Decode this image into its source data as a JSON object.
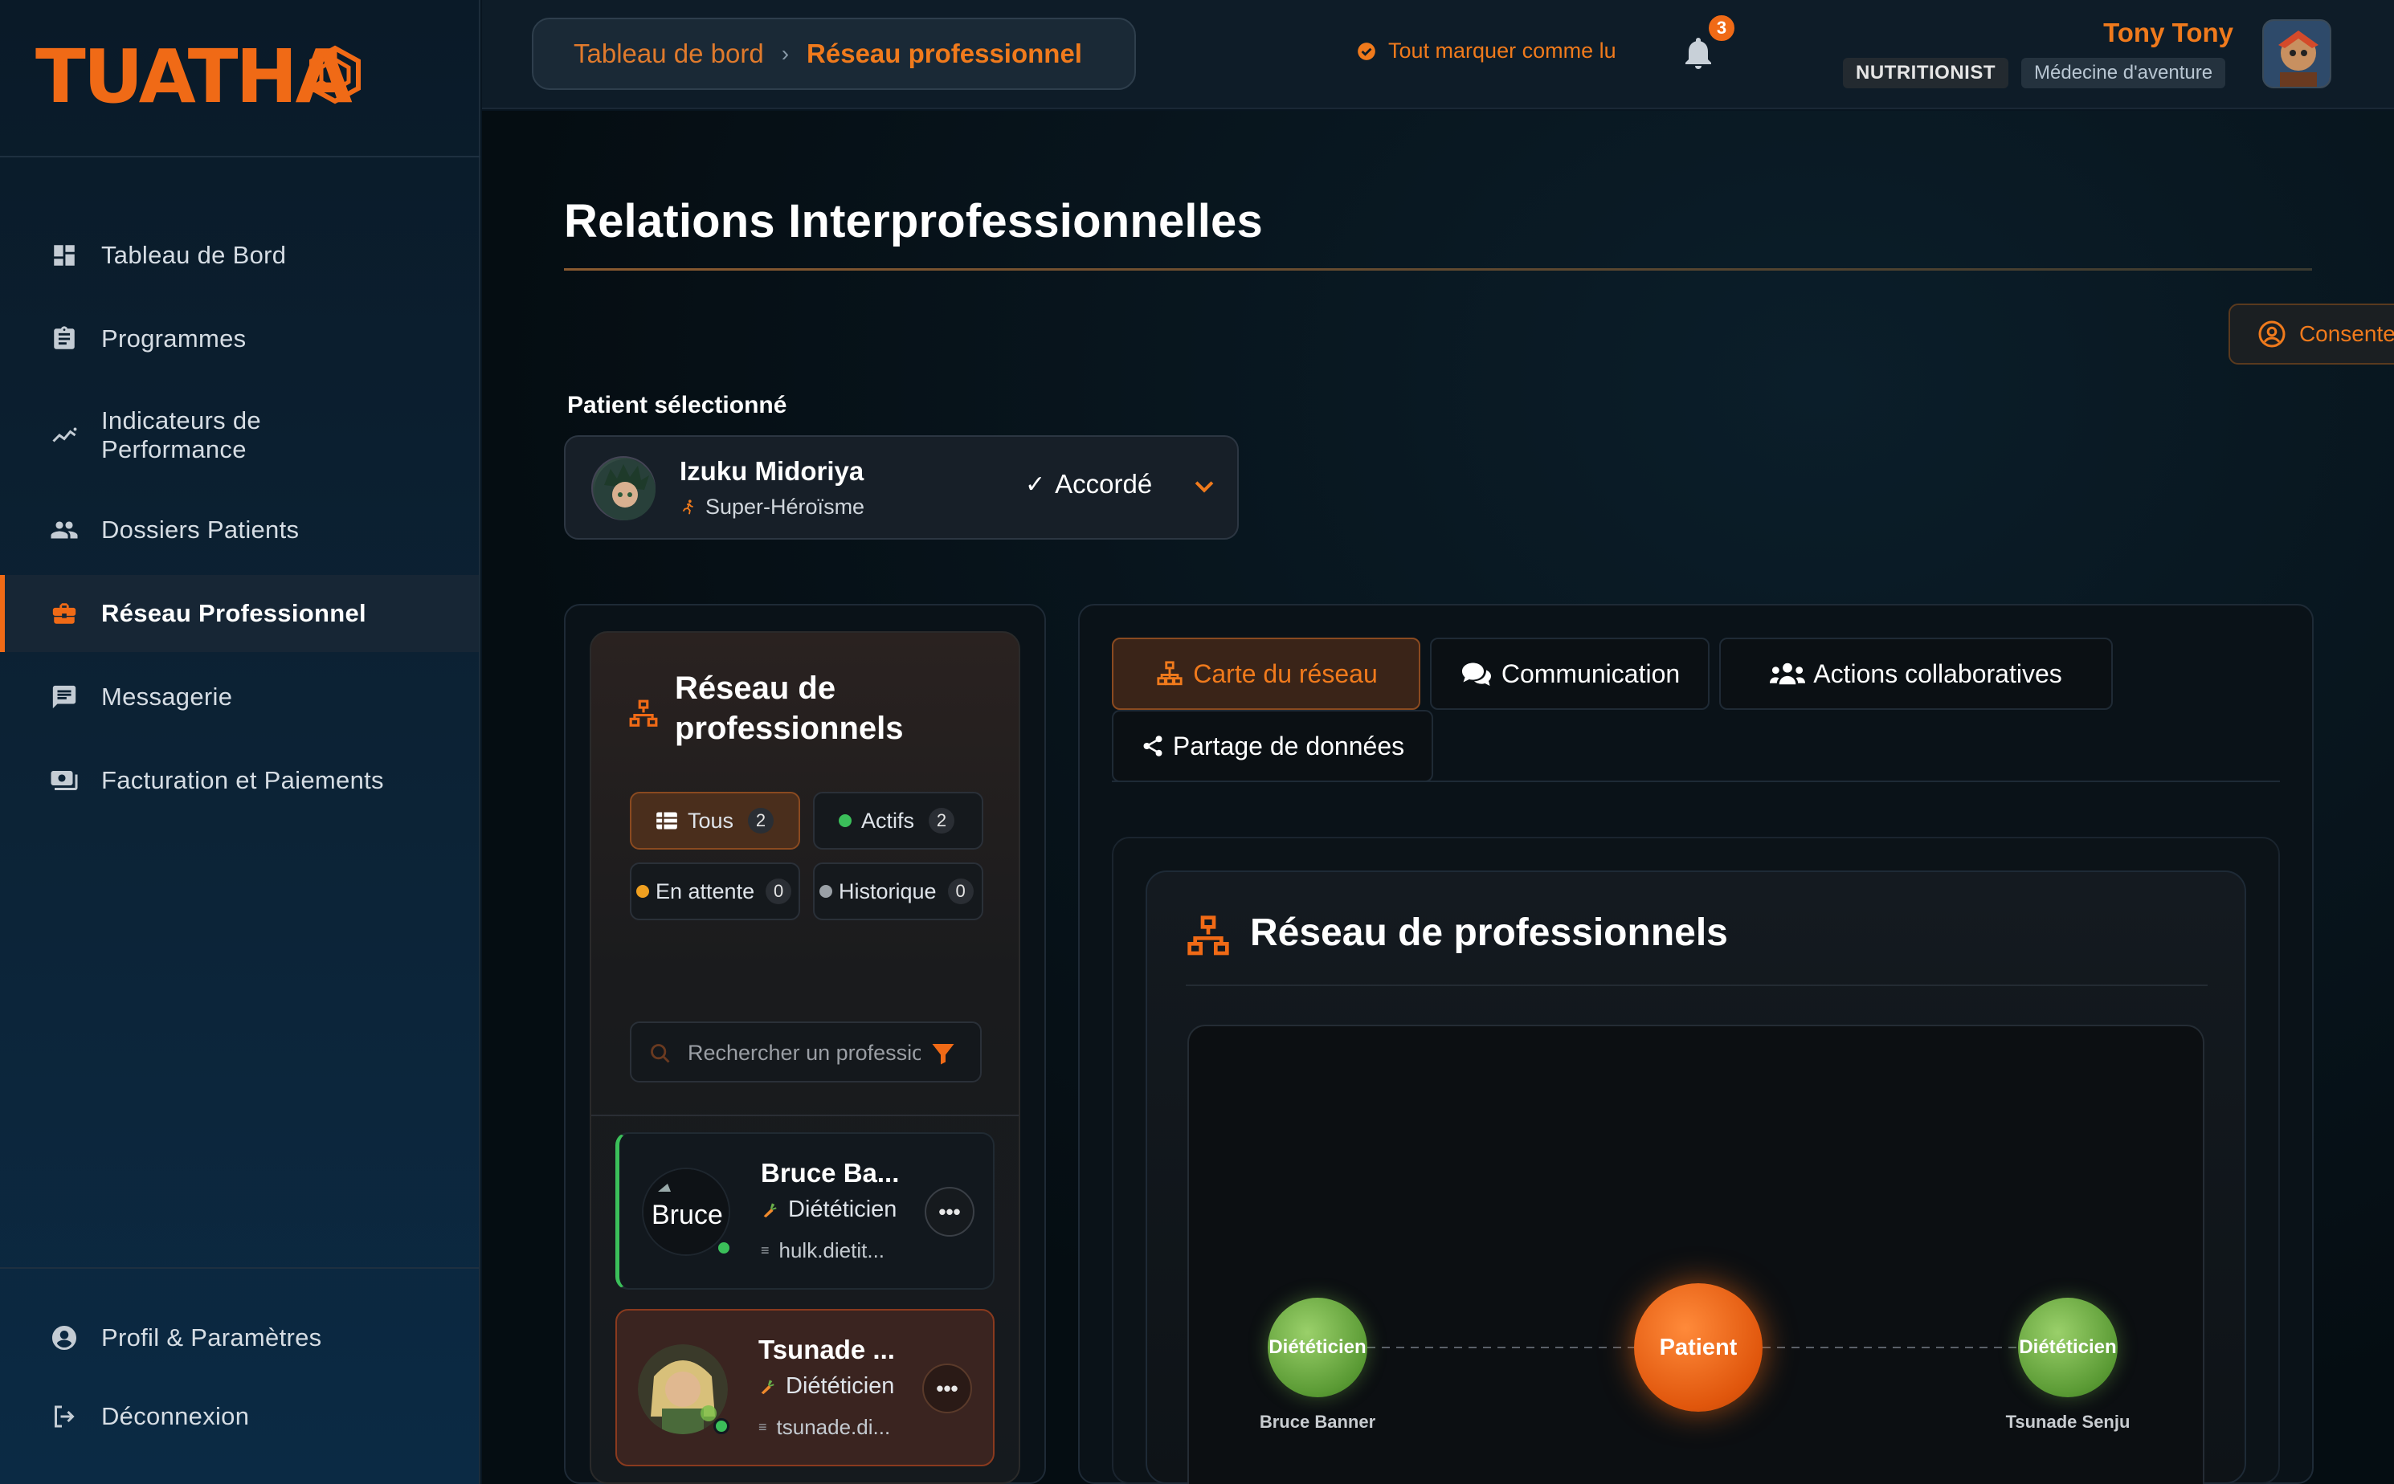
{
  "brand": {
    "logo": "TUATHA"
  },
  "sidebar": {
    "items": [
      {
        "label": "Tableau de Bord",
        "icon": "dashboard-icon"
      },
      {
        "label": "Programmes",
        "icon": "clipboard-icon"
      },
      {
        "label": "Indicateurs de Performance",
        "icon": "trending-up-icon"
      },
      {
        "label": "Dossiers Patients",
        "icon": "people-icon"
      },
      {
        "label": "Réseau Professionnel",
        "icon": "briefcase-icon",
        "active": true
      },
      {
        "label": "Messagerie",
        "icon": "message-icon"
      },
      {
        "label": "Facturation et Paiements",
        "icon": "payment-icon"
      }
    ],
    "bottom": [
      {
        "label": "Profil & Paramètres",
        "icon": "account-circle-icon"
      },
      {
        "label": "Déconnexion",
        "icon": "logout-icon"
      }
    ]
  },
  "topbar": {
    "breadcrumb": [
      "Tableau de bord",
      "Réseau professionnel"
    ],
    "mark_all_read": "Tout marquer comme lu",
    "notification_count": "3",
    "user_name": "Tony Tony",
    "role": "NUTRITIONIST",
    "specialty": "Médecine d'aventure"
  },
  "page": {
    "title": "Relations Interprofessionnelles",
    "consent_button": "Consentement",
    "patient_label": "Patient sélectionné"
  },
  "patient": {
    "name": "Izuku Midoriya",
    "sport": "Super-Héroïsme",
    "status": "Accordé"
  },
  "network_panel": {
    "title": "Réseau de professionnels",
    "filters": [
      {
        "label": "Tous",
        "count": "2"
      },
      {
        "label": "Actifs",
        "count": "2"
      },
      {
        "label": "En attente",
        "count": "0"
      },
      {
        "label": "Historique",
        "count": "0"
      }
    ],
    "search_placeholder": "Rechercher un professionnel",
    "professionals": [
      {
        "name": "Bruce Ba...",
        "role": "Diététicien",
        "email": "hulk.dietit...",
        "avatar_alt": "Bruce Banner"
      },
      {
        "name": "Tsunade ...",
        "role": "Diététicien",
        "email": "tsunade.di..."
      }
    ]
  },
  "tabs": [
    {
      "label": "Carte du réseau",
      "icon": "sitemap-icon"
    },
    {
      "label": "Communication",
      "icon": "comments-icon"
    },
    {
      "label": "Actions collaboratives",
      "icon": "users-icon"
    },
    {
      "label": "Partage de données",
      "icon": "share-icon"
    }
  ],
  "network_map": {
    "title": "Réseau de professionnels",
    "nodes": [
      {
        "label": "Diététicien",
        "caption": "Bruce Banner"
      },
      {
        "label": "Patient"
      },
      {
        "label": "Diététicien",
        "caption": "Tsunade Senju"
      }
    ]
  },
  "colors": {
    "accent": "#f06a16",
    "online": "#3bbf5a",
    "dietitian_node": "#6aaa3a"
  }
}
